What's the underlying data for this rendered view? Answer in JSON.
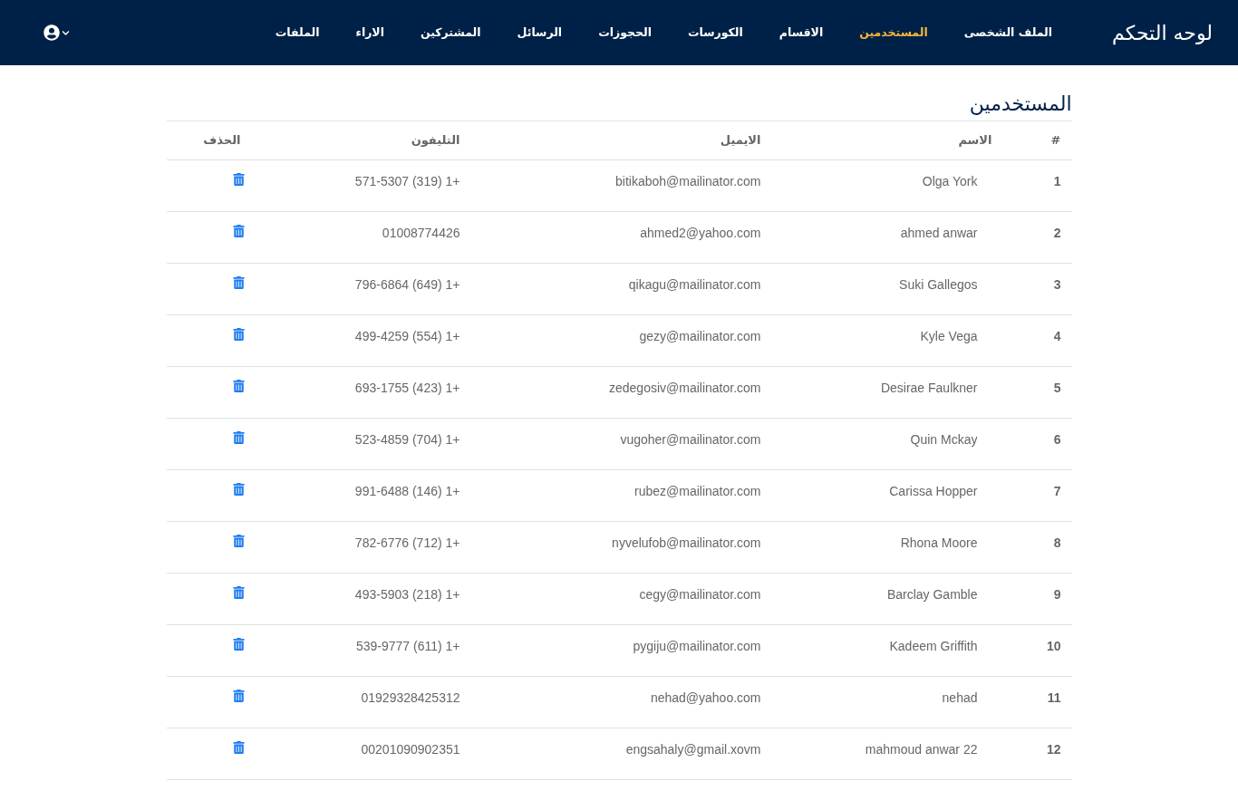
{
  "navbar": {
    "brand": "لوحه التحكم",
    "items": [
      {
        "label": "الملف الشخصى",
        "selected": false
      },
      {
        "label": "المستخدمين",
        "selected": true
      },
      {
        "label": "الاقسام",
        "selected": false
      },
      {
        "label": "الكورسات",
        "selected": false
      },
      {
        "label": "الحجوزات",
        "selected": false
      },
      {
        "label": "الرسائل",
        "selected": false
      },
      {
        "label": "المشتركين",
        "selected": false
      },
      {
        "label": "الاراء",
        "selected": false
      },
      {
        "label": "الملفات",
        "selected": false
      }
    ]
  },
  "page_title": "المستخدمين",
  "table": {
    "columns": [
      "#",
      "الاسم",
      "الايميل",
      "التليفون",
      "الحذف"
    ],
    "rows": [
      {
        "index": "1",
        "name": "Olga York",
        "email": "bitikaboh@mailinator.com",
        "phone": "+1 (319) 571-5307"
      },
      {
        "index": "2",
        "name": "ahmed anwar",
        "email": "ahmed2@yahoo.com",
        "phone": "01008774426"
      },
      {
        "index": "3",
        "name": "Suki Gallegos",
        "email": "qikagu@mailinator.com",
        "phone": "+1 (649) 796-6864"
      },
      {
        "index": "4",
        "name": "Kyle Vega",
        "email": "gezy@mailinator.com",
        "phone": "+1 (554) 499-4259"
      },
      {
        "index": "5",
        "name": "Desirae Faulkner",
        "email": "zedegosiv@mailinator.com",
        "phone": "+1 (423) 693-1755"
      },
      {
        "index": "6",
        "name": "Quin Mckay",
        "email": "vugoher@mailinator.com",
        "phone": "+1 (704) 523-4859"
      },
      {
        "index": "7",
        "name": "Carissa Hopper",
        "email": "rubez@mailinator.com",
        "phone": "+1 (146) 991-6488"
      },
      {
        "index": "8",
        "name": "Rhona Moore",
        "email": "nyvelufob@mailinator.com",
        "phone": "+1 (712) 782-6776"
      },
      {
        "index": "9",
        "name": "Barclay Gamble",
        "email": "cegy@mailinator.com",
        "phone": "+1 (218) 493-5903"
      },
      {
        "index": "10",
        "name": "Kadeem Griffith",
        "email": "pygiju@mailinator.com",
        "phone": "+1 (611) 539-9777"
      },
      {
        "index": "11",
        "name": "nehad",
        "email": "nehad@yahoo.com",
        "phone": "01929328425312"
      },
      {
        "index": "12",
        "name": "mahmoud anwar 22",
        "email": "engsahaly@gmail.xovm",
        "phone": "00201090902351"
      }
    ]
  }
}
